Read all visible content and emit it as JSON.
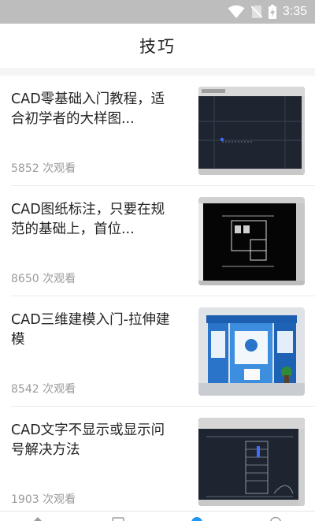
{
  "status_bar": {
    "time": "3:35",
    "icons": [
      "wifi-icon",
      "no-sim-icon",
      "battery-charging-icon"
    ]
  },
  "header": {
    "title": "技巧"
  },
  "articles": [
    {
      "title": "CAD零基础入门教程，适合初学者的大样图...",
      "views": "5852 次观看",
      "thumb": "cad-drawing-thumbnail"
    },
    {
      "title": "CAD图纸标注，只要在规范的基础上，首位...",
      "views": "8650 次观看",
      "thumb": "cad-annotation-thumbnail"
    },
    {
      "title": "CAD三维建模入门-拉伸建模",
      "views": "8542 次观看",
      "thumb": "exhibition-booth-3d-thumbnail"
    },
    {
      "title": "CAD文字不显示或显示问号解决方法",
      "views": "1903 次观看",
      "thumb": "cad-staircase-thumbnail"
    }
  ],
  "bottom_nav": {
    "icons": [
      "home-icon",
      "book-icon",
      "tips-icon",
      "profile-icon"
    ]
  },
  "colors": {
    "status_bar": "#bdbdbd",
    "accent": "#2196f3",
    "cad_background": "#1e2530"
  }
}
